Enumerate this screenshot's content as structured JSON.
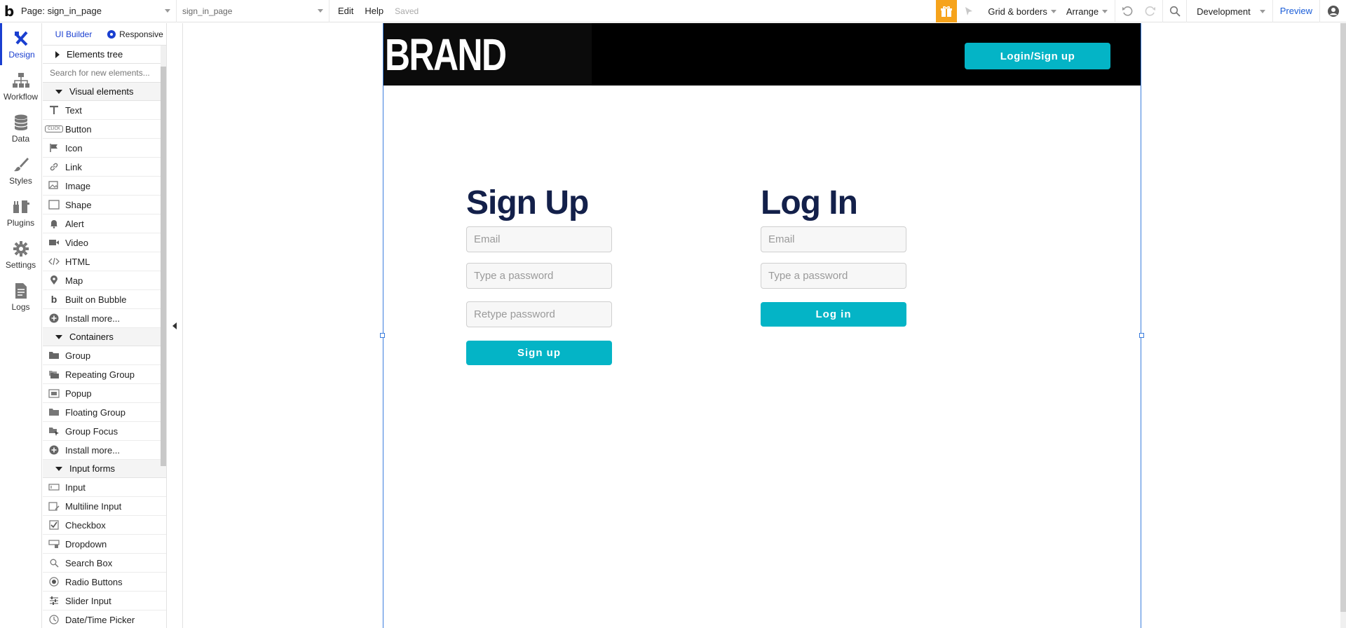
{
  "topbar": {
    "logo": "b",
    "page_select": "Page: sign_in_page",
    "element_select": "sign_in_page",
    "menu_edit": "Edit",
    "menu_help": "Help",
    "saved": "Saved",
    "grid_borders": "Grid & borders",
    "arrange": "Arrange",
    "environment": "Development",
    "preview": "Preview",
    "accent": "#f6a31b"
  },
  "leftnav": {
    "items": [
      {
        "label": "Design",
        "icon": "design-icon",
        "active": true
      },
      {
        "label": "Workflow",
        "icon": "workflow-icon"
      },
      {
        "label": "Data",
        "icon": "database-icon"
      },
      {
        "label": "Styles",
        "icon": "brush-icon"
      },
      {
        "label": "Plugins",
        "icon": "plugin-icon"
      },
      {
        "label": "Settings",
        "icon": "gear-icon"
      },
      {
        "label": "Logs",
        "icon": "document-icon"
      }
    ]
  },
  "palette": {
    "tab_ui_builder": "UI Builder",
    "tab_responsive": "Responsive",
    "elements_tree": "Elements tree",
    "search_placeholder": "Search for new elements...",
    "visual_elements": "Visual elements",
    "visual_items": [
      "Text",
      "Button",
      "Icon",
      "Link",
      "Image",
      "Shape",
      "Alert",
      "Video",
      "HTML",
      "Map",
      "Built on Bubble",
      "Install more..."
    ],
    "containers": "Containers",
    "container_items": [
      "Group",
      "Repeating Group",
      "Popup",
      "Floating Group",
      "Group Focus",
      "Install more..."
    ],
    "input_forms": "Input forms",
    "input_items": [
      "Input",
      "Multiline Input",
      "Checkbox",
      "Dropdown",
      "Search Box",
      "Radio Buttons",
      "Slider Input",
      "Date/Time Picker"
    ],
    "button_icon_text": "CLICK"
  },
  "canvas": {
    "brand": "BRAND",
    "header_button": "Login/Sign up",
    "accent": "#04b4c6",
    "title_color": "#13204a",
    "signup": {
      "title": "Sign Up",
      "email_placeholder": "Email",
      "password_placeholder": "Type a password",
      "retype_placeholder": "Retype password",
      "button": "Sign up"
    },
    "login": {
      "title": "Log In",
      "email_placeholder": "Email",
      "password_placeholder": "Type a password",
      "button": "Log in"
    }
  }
}
